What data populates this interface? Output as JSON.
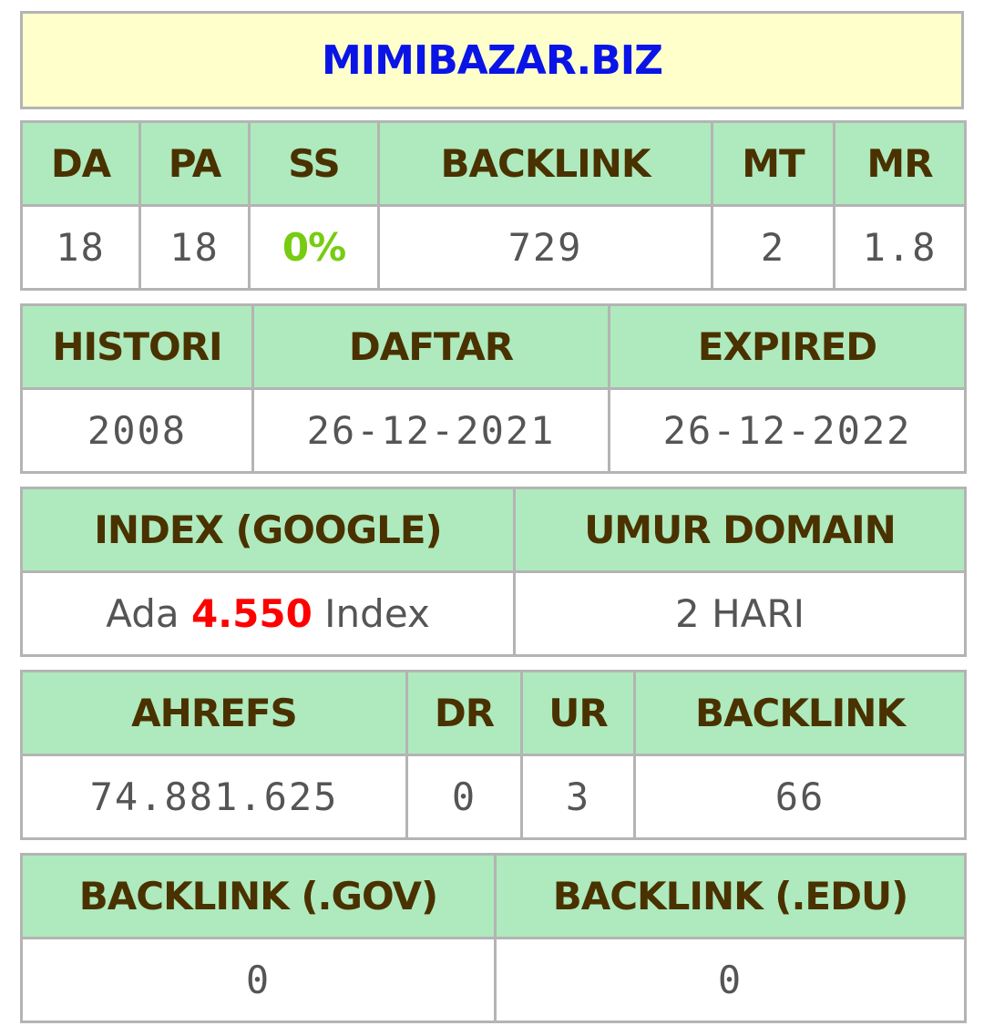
{
  "domain_title": "MIMIBAZAR.BIZ",
  "moz": {
    "headers": [
      "DA",
      "PA",
      "SS",
      "BACKLINK",
      "MT",
      "MR"
    ],
    "values": [
      "18",
      "18",
      "0%",
      "729",
      "2",
      "1.8"
    ]
  },
  "registration": {
    "headers": [
      "HISTORI",
      "DAFTAR",
      "EXPIRED"
    ],
    "values": [
      "2008",
      "26-12-2021",
      "26-12-2022"
    ]
  },
  "index": {
    "headers": [
      "INDEX (GOOGLE)",
      "UMUR DOMAIN"
    ],
    "index_prefix": "Ada",
    "index_count": "4.550",
    "index_suffix": "Index",
    "age": "2 HARI"
  },
  "ahrefs": {
    "headers": [
      "AHREFS",
      "DR",
      "UR",
      "BACKLINK"
    ],
    "values": [
      "74.881.625",
      "0",
      "3",
      "66"
    ]
  },
  "special_backlinks": {
    "headers": [
      "BACKLINK (.GOV)",
      "BACKLINK (.EDU)"
    ],
    "values": [
      "0",
      "0"
    ]
  },
  "colors": {
    "title_bg": "#ffffcc",
    "title_text": "#0a14e6",
    "header_bg": "#aeeabd",
    "header_text": "#4a3100",
    "value_text": "#555555",
    "ss_text": "#77cc11",
    "index_count_text": "#ff0000",
    "border": "#b4b4b4"
  }
}
